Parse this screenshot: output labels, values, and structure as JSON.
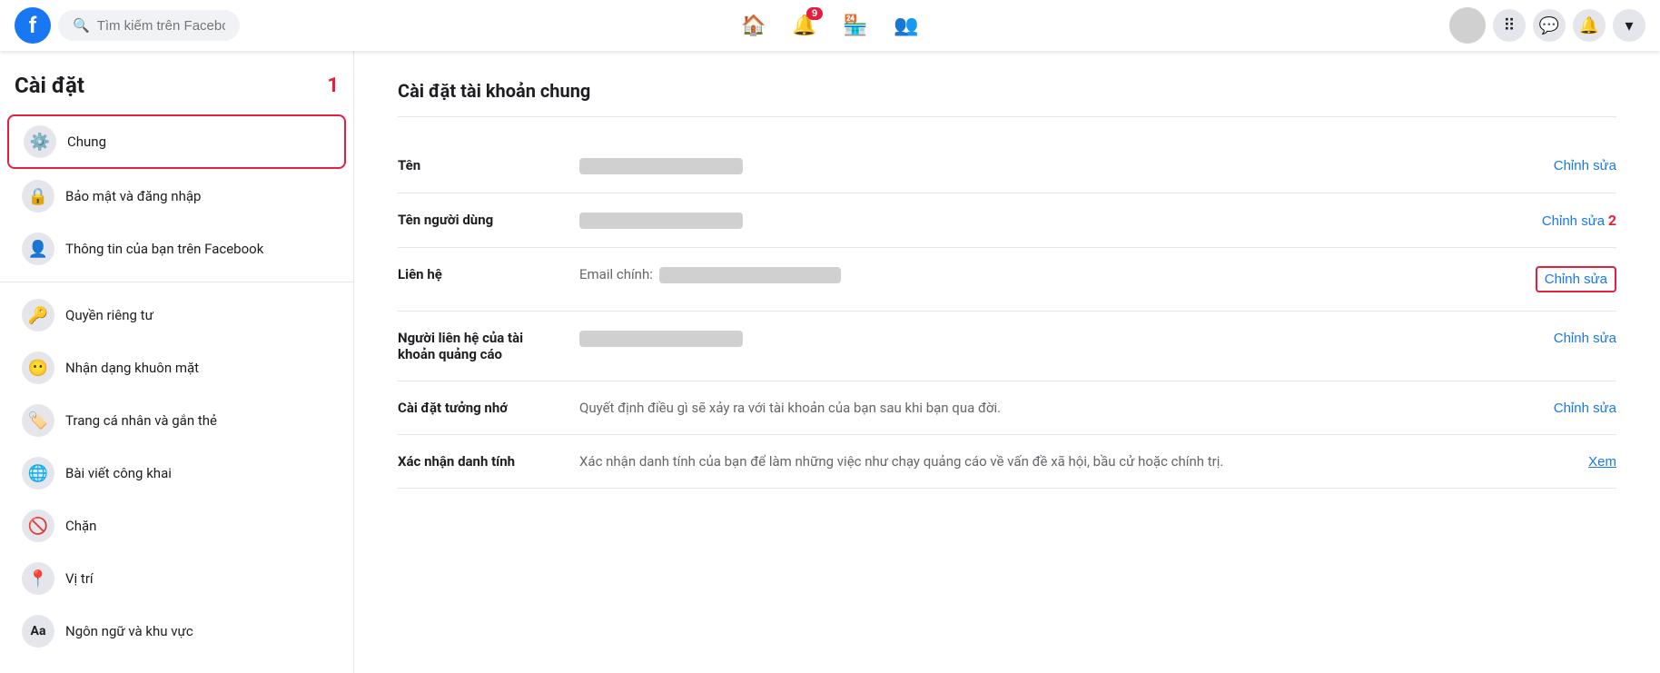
{
  "topnav": {
    "logo": "f",
    "search_placeholder": "Tìm kiếm trên Facebook",
    "nav_badge": "9",
    "avatar_color": "#c0c0c0"
  },
  "sidebar": {
    "title": "Cài đặt",
    "badge": "1",
    "items": [
      {
        "id": "chung",
        "label": "Chung",
        "icon": "⚙️",
        "active": true
      },
      {
        "id": "bao-mat",
        "label": "Bảo mật và đăng nhập",
        "icon": "🔒",
        "active": false
      },
      {
        "id": "thong-tin",
        "label": "Thông tin của bạn trên Facebook",
        "icon": "👤",
        "active": false
      },
      {
        "id": "quyen-rieng-tu",
        "label": "Quyền riêng tư",
        "icon": "🔑",
        "active": false
      },
      {
        "id": "nhan-dang",
        "label": "Nhận dạng khuôn mặt",
        "icon": "😶",
        "active": false
      },
      {
        "id": "trang-ca-nhan",
        "label": "Trang cá nhân và gắn thẻ",
        "icon": "🏷️",
        "active": false
      },
      {
        "id": "bai-viet",
        "label": "Bài viết công khai",
        "icon": "🌐",
        "active": false
      },
      {
        "id": "chan",
        "label": "Chặn",
        "icon": "🚫",
        "active": false
      },
      {
        "id": "vi-tri",
        "label": "Vị trí",
        "icon": "📍",
        "active": false
      },
      {
        "id": "ngon-ngu",
        "label": "Ngôn ngữ và khu vực",
        "icon": "Aa",
        "active": false
      }
    ]
  },
  "content": {
    "title": "Cài đặt tài khoản chung",
    "badge2": "2",
    "rows": [
      {
        "id": "ten",
        "label": "Tên",
        "value_type": "blurred",
        "action": "Chỉnh sửa",
        "action_type": "edit",
        "boxed": false
      },
      {
        "id": "ten-nguoi-dung",
        "label": "Tên người dùng",
        "value_type": "blurred",
        "action": "Chỉnh sửa",
        "action_type": "edit",
        "boxed": false
      },
      {
        "id": "lien-he",
        "label": "Liên hệ",
        "value_prefix": "Email chính:",
        "value_type": "blurred_inline",
        "action": "Chỉnh sửa",
        "action_type": "edit",
        "boxed": true
      },
      {
        "id": "nguoi-lien-he",
        "label": "Người liên hệ của tài\nkhoản quảng cáo",
        "value_type": "blurred",
        "action": "Chỉnh sửa",
        "action_type": "edit",
        "boxed": false
      },
      {
        "id": "tuong-nho",
        "label": "Cài đặt tưởng nhớ",
        "value_text": "Quyết định điều gì sẽ xảy ra với tài khoản của bạn sau khi bạn qua đời.",
        "action": "Chỉnh sửa",
        "action_type": "edit",
        "boxed": false
      },
      {
        "id": "xac-nhan",
        "label": "Xác nhận danh tính",
        "value_text": "Xác nhận danh tính của bạn để làm những việc như chạy quảng cáo về vấn đề xã hội, bầu cử hoặc chính trị.",
        "action": "Xem",
        "action_type": "view",
        "boxed": false
      }
    ]
  }
}
